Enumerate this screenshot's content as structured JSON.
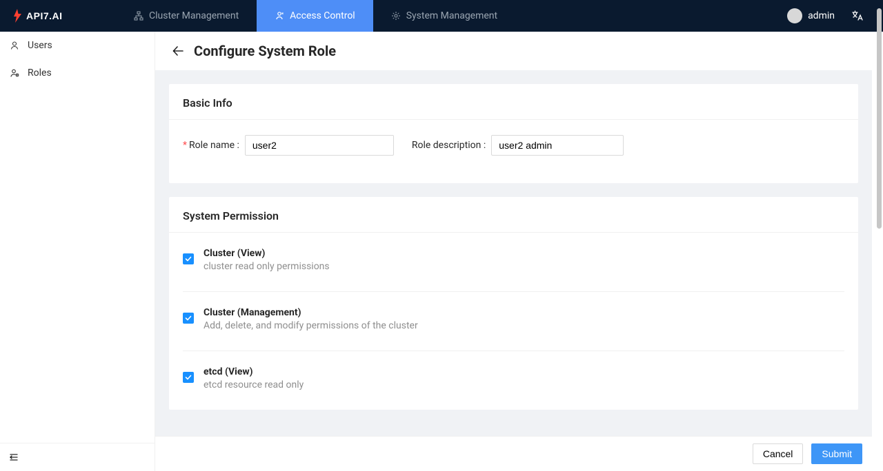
{
  "header": {
    "brand": "api7.ai",
    "nav": [
      {
        "label": "Cluster Management",
        "icon": "cluster-icon"
      },
      {
        "label": "Access Control",
        "icon": "access-icon",
        "active": true
      },
      {
        "label": "System Management",
        "icon": "gear-icon"
      }
    ],
    "user": "admin"
  },
  "sidebar": {
    "items": [
      {
        "label": "Users",
        "icon": "user-icon"
      },
      {
        "label": "Roles",
        "icon": "role-icon"
      }
    ]
  },
  "page": {
    "title": "Configure System Role"
  },
  "basicInfo": {
    "section_title": "Basic Info",
    "role_name_label": "Role name",
    "role_name_value": "user2",
    "role_desc_label": "Role description",
    "role_desc_value": "user2 admin"
  },
  "systemPermission": {
    "section_title": "System Permission",
    "items": [
      {
        "title": "Cluster (View)",
        "desc": "cluster read only permissions",
        "checked": true
      },
      {
        "title": "Cluster (Management)",
        "desc": "Add, delete, and modify permissions of the cluster",
        "checked": true
      },
      {
        "title": "etcd (View)",
        "desc": "etcd resource read only",
        "checked": true
      }
    ]
  },
  "footer": {
    "cancel": "Cancel",
    "submit": "Submit"
  }
}
